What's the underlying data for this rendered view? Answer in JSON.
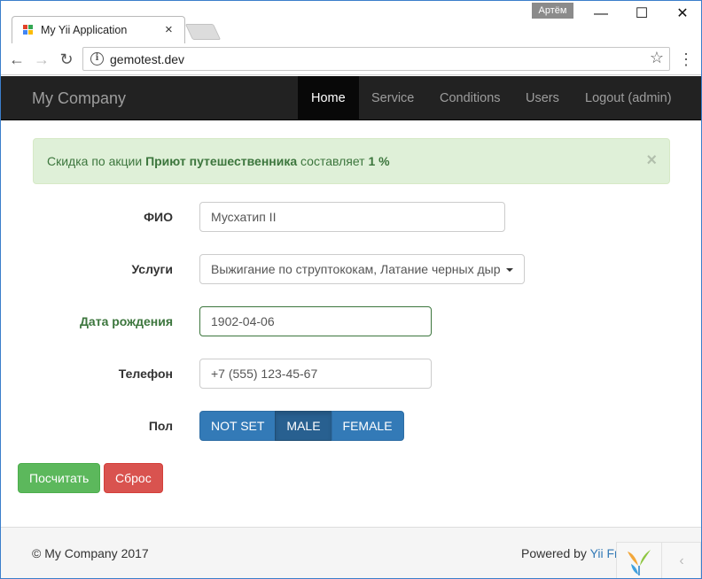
{
  "browser": {
    "tab_title": "My Yii Application",
    "tab_close": "×",
    "user_badge": "Артём",
    "url": "gemotest.dev",
    "window_controls": [
      "—",
      "☐",
      "✕"
    ]
  },
  "navbar": {
    "brand": "My Company",
    "items": [
      {
        "label": "Home",
        "active": true
      },
      {
        "label": "Service",
        "active": false
      },
      {
        "label": "Conditions",
        "active": false
      },
      {
        "label": "Users",
        "active": false
      },
      {
        "label": "Logout (admin)",
        "active": false
      }
    ]
  },
  "alert": {
    "prefix": "Скидка по акции ",
    "promo": "Приют путешественника",
    "middle": " составляет ",
    "discount": "1 %",
    "close": "×"
  },
  "form": {
    "fio_label": "ФИО",
    "fio_value": "Мусхатип II",
    "services_label": "Услуги",
    "services_value": "Выжигание по струптококам, Латание черных дыр",
    "birthdate_label": "Дата рождения",
    "birthdate_value": "1902-04-06",
    "phone_label": "Телефон",
    "phone_value": "+7 (555) 123-45-67",
    "gender_label": "Пол",
    "gender_options": [
      "NOT SET",
      "MALE",
      "FEMALE"
    ],
    "gender_selected": "MALE",
    "submit_label": "Посчитать",
    "reset_label": "Сброс"
  },
  "footer": {
    "copyright": "© My Company 2017",
    "powered_prefix": "Powered by ",
    "powered_link": "Yii Fr"
  },
  "colors": {
    "primary": "#337ab7",
    "success": "#5cb85c",
    "danger": "#d9534f",
    "navbar": "#222222"
  }
}
